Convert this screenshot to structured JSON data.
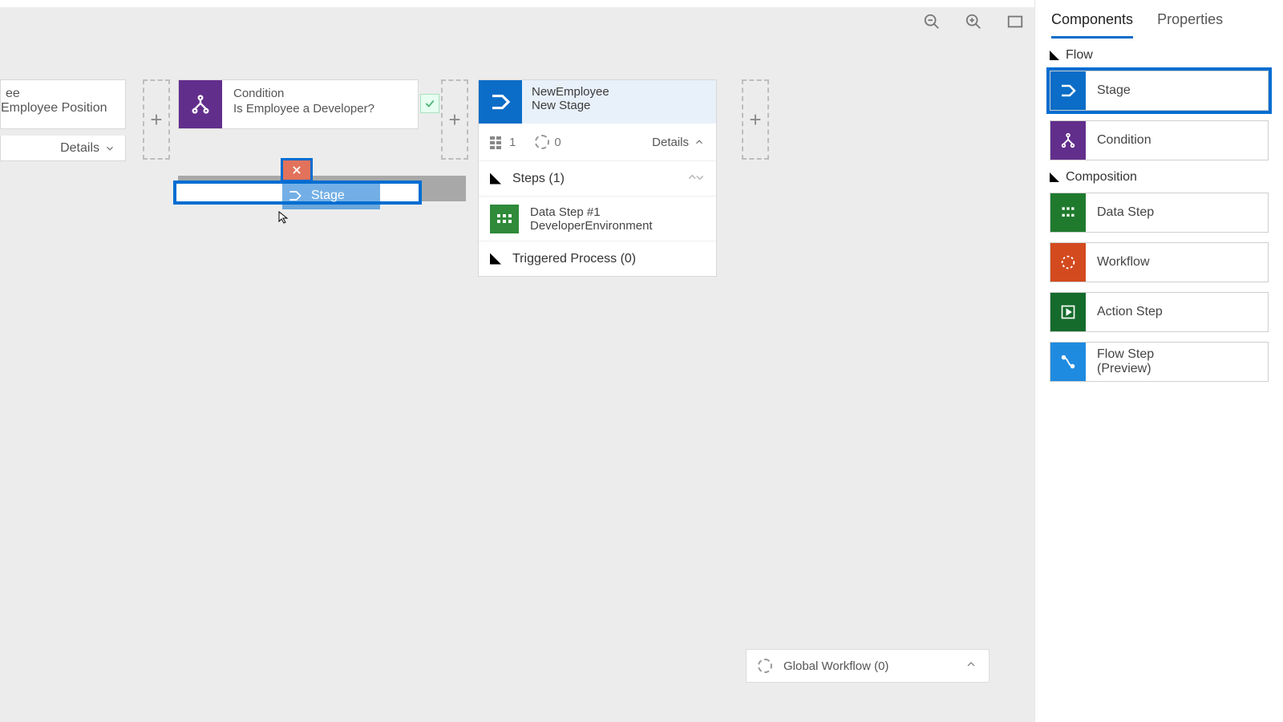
{
  "tabs": {
    "components": "Components",
    "properties": "Properties"
  },
  "sections": {
    "flow": "Flow",
    "composition": "Composition"
  },
  "palette": {
    "stage": "Stage",
    "condition": "Condition",
    "data_step": "Data Step",
    "workflow": "Workflow",
    "action_step": "Action Step",
    "flow_step": "Flow Step\n(Preview)"
  },
  "partial_node": {
    "line1": "ee",
    "line2": "Employee Position",
    "details": "Details"
  },
  "condition_node": {
    "title": "Condition",
    "subtitle": "Is Employee a Developer?"
  },
  "stage_node": {
    "title": "NewEmployee",
    "subtitle": "New Stage",
    "steps_count": "1",
    "wf_count": "0",
    "details": "Details",
    "steps_header": "Steps (1)",
    "step1_title": "Data Step #1",
    "step1_sub": "DeveloperEnvironment",
    "triggered": "Triggered Process (0)"
  },
  "drag_ghost": "Stage",
  "global_workflow": "Global Workflow (0)"
}
